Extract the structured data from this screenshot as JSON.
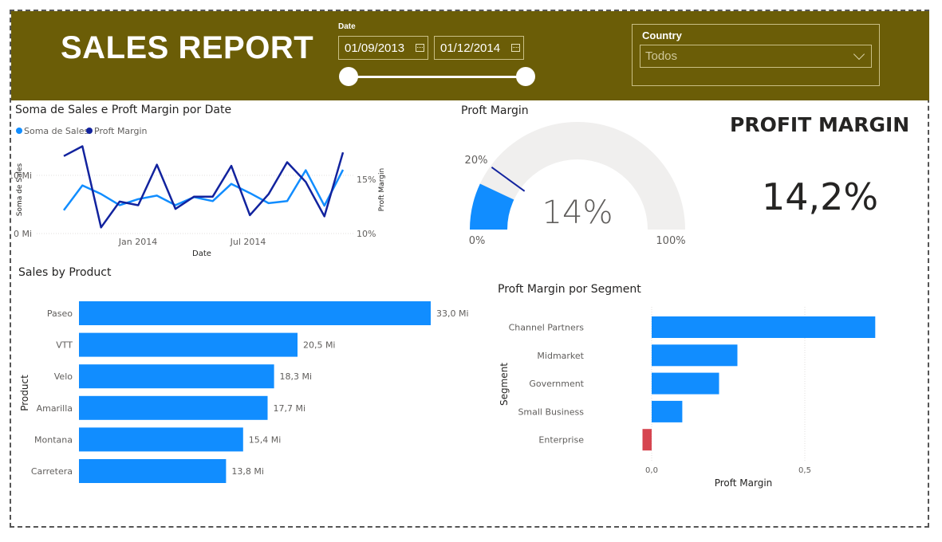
{
  "header": {
    "title": "SALES REPORT",
    "date_label": "Date",
    "start_date": "01/09/2013",
    "end_date": "01/12/2014",
    "country_label": "Country",
    "country_value": "Todos"
  },
  "line_chart": {
    "title": "Soma de Sales e Proft Margin por Date",
    "legend": [
      "Soma de  Sales",
      "Proft Margin"
    ],
    "y_left_label": "Soma de Sales",
    "y_right_label": "Proft Margin",
    "x_label": "Date",
    "y_left_ticks": [
      "10 Mi",
      "0 Mi"
    ],
    "y_right_ticks": [
      "15%",
      "10%"
    ],
    "x_ticks": [
      "Jan 2014",
      "Jul 2014"
    ]
  },
  "gauge": {
    "title": "Proft Margin",
    "value_label": "14%",
    "min_label": "0%",
    "max_label": "100%",
    "target_label": "20%"
  },
  "kpi": {
    "title": "PROFIT MARGIN",
    "value": "14,2%"
  },
  "product_chart": {
    "title": "Sales by Product",
    "axis_label": "Product"
  },
  "segment_chart": {
    "title": "Proft Margin por Segment",
    "y_axis_label": "Segment",
    "x_axis_label": "Proft Margin",
    "x_ticks": [
      "0,0",
      "0,5"
    ]
  },
  "colors": {
    "header_bg": "#6b5d07",
    "sales": "#118dff",
    "margin": "#12239e",
    "negative": "#d64550",
    "gauge_track": "#f0efee"
  },
  "chart_data": [
    {
      "type": "line",
      "title": "Soma de Sales e Proft Margin por Date",
      "x": [
        "Sep 2013",
        "Oct 2013",
        "Nov 2013",
        "Dec 2013",
        "Jan 2014",
        "Feb 2014",
        "Mar 2014",
        "Apr 2014",
        "May 2014",
        "Jun 2014",
        "Jul 2014",
        "Aug 2014",
        "Sep 2014",
        "Oct 2014",
        "Nov 2014",
        "Dec 2014"
      ],
      "series": [
        {
          "name": "Soma de  Sales",
          "axis": "left",
          "values": [
            4.6,
            9.5,
            7.8,
            5.6,
            6.8,
            7.5,
            5.6,
            7.2,
            6.4,
            9.8,
            8.0,
            6.0,
            6.4,
            12.5,
            5.5,
            12.6
          ]
        },
        {
          "name": "Proft Margin",
          "axis": "right",
          "values": [
            16.3,
            17.1,
            10.5,
            12.6,
            12.3,
            15.6,
            12.0,
            13.0,
            13.0,
            15.5,
            11.5,
            13.2,
            15.8,
            14.2,
            11.4,
            16.6
          ]
        }
      ],
      "xlabel": "Date",
      "ylabel": "Soma de Sales",
      "y2label": "Proft Margin",
      "ylim": [
        0,
        17
      ],
      "y2lim": [
        10,
        17
      ],
      "xticks": [
        "Jan 2014",
        "Jul 2014"
      ]
    },
    {
      "type": "gauge",
      "title": "Proft Margin",
      "value": 14,
      "min": 0,
      "max": 100,
      "target": 20
    },
    {
      "type": "bar",
      "title": "Sales by Product",
      "categories": [
        "Paseo",
        "VTT",
        "Velo",
        "Amarilla",
        "Montana",
        "Carretera"
      ],
      "values": [
        33.0,
        20.5,
        18.3,
        17.7,
        15.4,
        13.8
      ],
      "value_labels": [
        "33,0 Mi",
        "20,5 Mi",
        "18,3 Mi",
        "17,7 Mi",
        "15,4 Mi",
        "13,8 Mi"
      ],
      "ylabel": "Product",
      "xlim": [
        0,
        33
      ]
    },
    {
      "type": "bar",
      "title": "Proft Margin por Segment",
      "categories": [
        "Channel Partners",
        "Midmarket",
        "Government",
        "Small Business",
        "Enterprise"
      ],
      "values": [
        0.73,
        0.28,
        0.22,
        0.1,
        -0.03
      ],
      "xlabel": "Proft Margin",
      "ylabel": "Segment",
      "xlim": [
        -0.04,
        0.75
      ],
      "xticks": [
        "0,0",
        "0,5"
      ]
    }
  ]
}
